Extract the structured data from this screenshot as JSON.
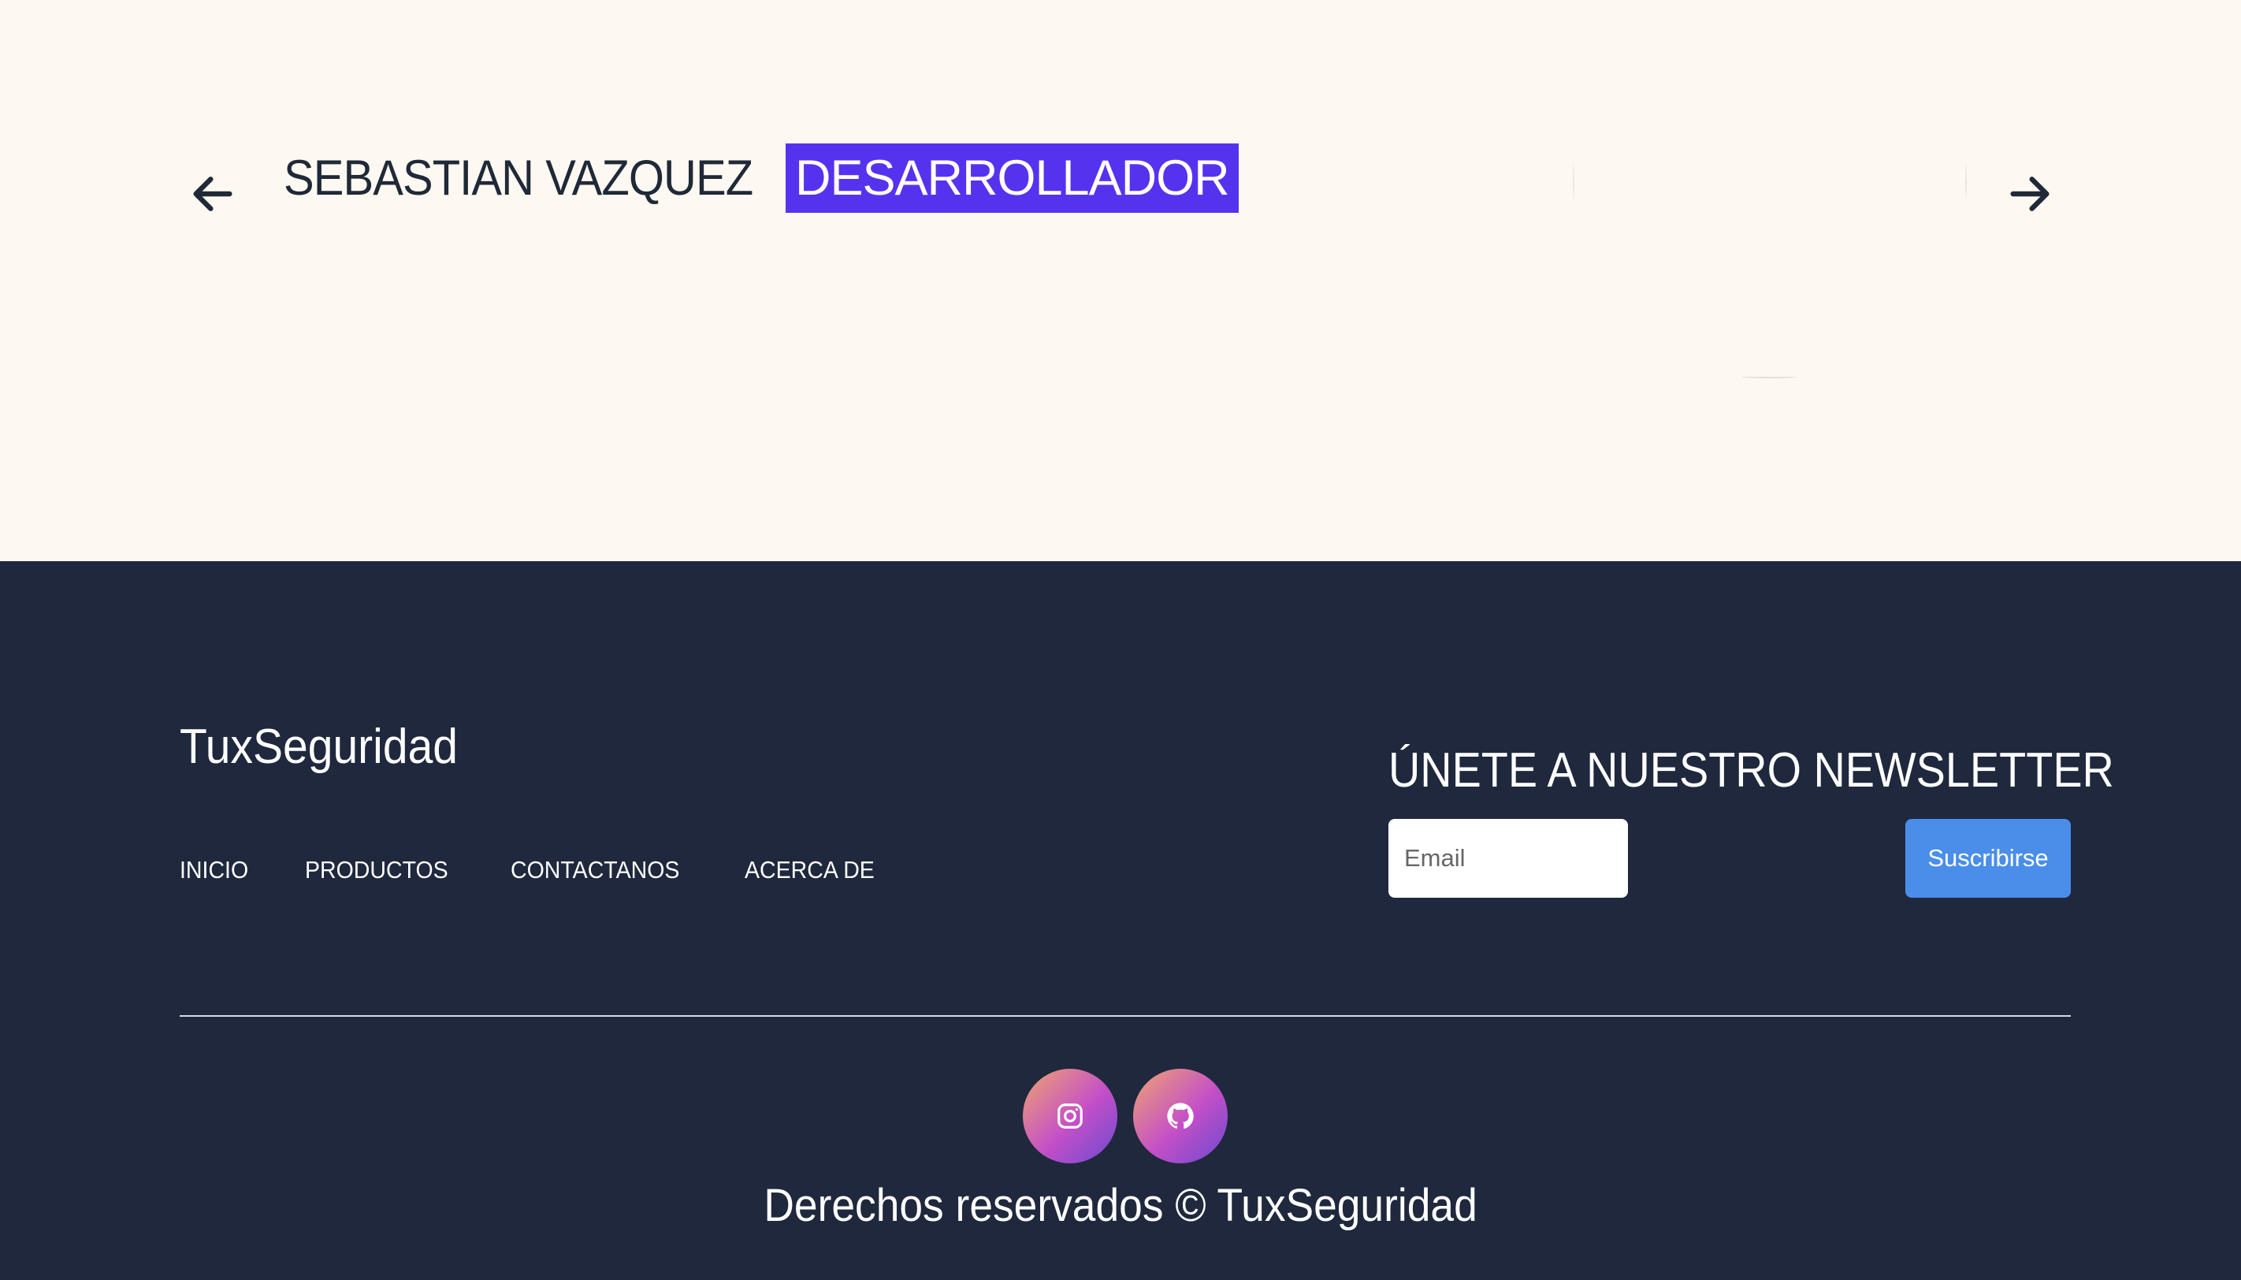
{
  "hero": {
    "name": "SEBASTIAN VAZQUEZ",
    "role": "DESARROLLADOR",
    "prev_icon": "arrow-left-icon",
    "next_icon": "arrow-right-icon"
  },
  "footer": {
    "brand": "TuxSeguridad",
    "nav": [
      "INICIO",
      "PRODUCTOS",
      "CONTACTANOS",
      "ACERCA DE"
    ],
    "newsletter": {
      "title": "ÚNETE A NUESTRO NEWSLETTER",
      "email_placeholder": "Email",
      "email_value": "",
      "button_label": "Suscribirse"
    },
    "socials": [
      "instagram-icon",
      "github-icon"
    ],
    "copyright": "Derechos reservados © TuxSeguridad"
  },
  "colors": {
    "page_bg": "#fdf8f2",
    "footer_bg": "#1f283d",
    "role_highlight": "#5533ee",
    "button": "#4a8eea",
    "text_dark": "#1f2937"
  }
}
